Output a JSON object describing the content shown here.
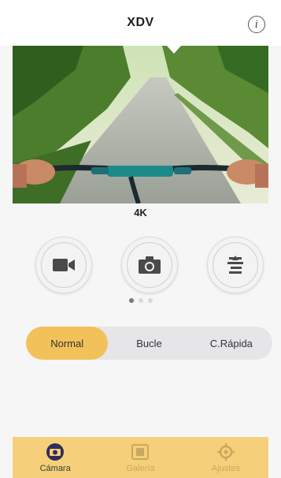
{
  "header": {
    "title": "XDV",
    "info_icon": "info-icon"
  },
  "preview": {
    "resolution": "4K"
  },
  "modes": [
    {
      "name": "video",
      "icon": "video-camera-icon"
    },
    {
      "name": "photo",
      "icon": "camera-icon"
    },
    {
      "name": "settings",
      "icon": "settings-icon"
    }
  ],
  "pager": {
    "count": 3,
    "active": 0
  },
  "segments": [
    {
      "label": "Normal"
    },
    {
      "label": "Bucle"
    },
    {
      "label": "C.Rápida"
    }
  ],
  "tabs": [
    {
      "label": "Cámara",
      "icon": "camera-tab-icon"
    },
    {
      "label": "Galería",
      "icon": "gallery-icon"
    },
    {
      "label": "Ajustes",
      "icon": "settings-gear-icon"
    }
  ],
  "colors": {
    "accent": "#f2c15a",
    "tabbar": "#f6cf7a"
  }
}
